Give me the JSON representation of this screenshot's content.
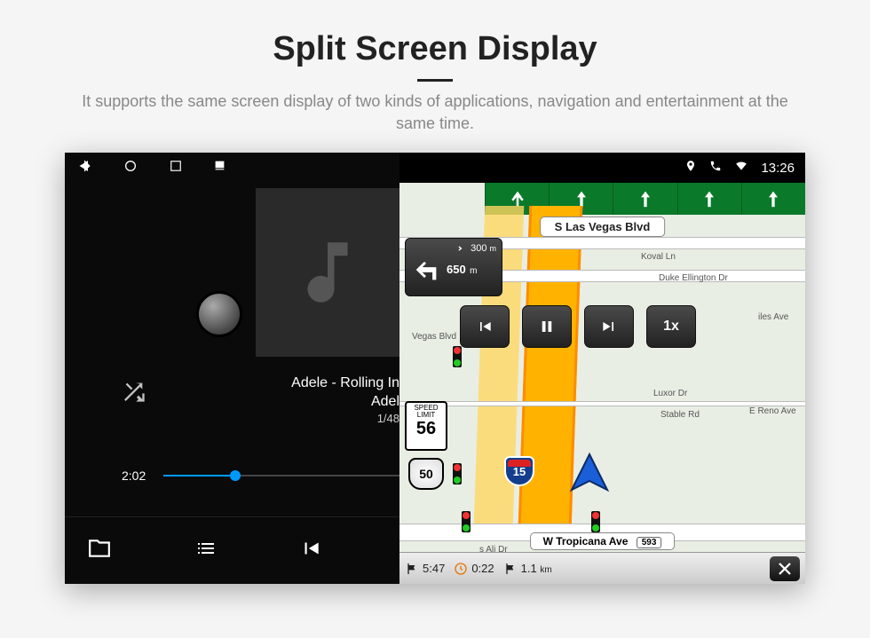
{
  "heading": {
    "title": "Split Screen Display",
    "subtitle": "It supports the same screen display of two kinds of applications, navigation and entertainment at the same time."
  },
  "status_bar": {
    "time": "13:26"
  },
  "player": {
    "track_title": "Adele - Rolling In",
    "track_artist": "Adel",
    "track_index": "1/48",
    "elapsed": "2:02"
  },
  "navigation": {
    "lanes_count": 5,
    "street_top": "S Las Vegas Blvd",
    "street_bottom": "W Tropicana Ave",
    "street_bottom_ref": "593",
    "turn_next_distance": "300",
    "turn_next_unit": "m",
    "turn_main_distance": "650",
    "turn_main_unit": "m",
    "speed_limit_label_top": "SPEED",
    "speed_limit_label_bot": "LIMIT",
    "speed_limit_value": "56",
    "highway_ref": "50",
    "interstate_ref": "15",
    "playback_speed": "1x",
    "roads": {
      "koval": "Koval Ln",
      "duke": "Duke Ellington Dr",
      "vegas": "Vegas Blvd",
      "luxor": "Luxor Dr",
      "stable": "Stable Rd",
      "reno": "E Reno Ave",
      "ali": "s Ali Dr",
      "iles": "iles Ave"
    },
    "eta": "5:47",
    "remaining_time": "0:22",
    "remaining_dist_value": "1.1",
    "remaining_dist_unit": "km"
  }
}
